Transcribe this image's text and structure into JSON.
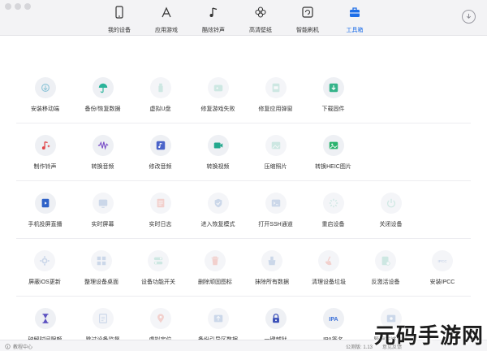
{
  "nav": {
    "items": [
      {
        "label": "我的设备",
        "icon": "phone-icon"
      },
      {
        "label": "应用游戏",
        "icon": "app-store-icon"
      },
      {
        "label": "酷炫铃声",
        "icon": "music-note-icon"
      },
      {
        "label": "高清壁纸",
        "icon": "flower-icon"
      },
      {
        "label": "智能刷机",
        "icon": "flash-icon"
      },
      {
        "label": "工具箱",
        "icon": "toolbox-icon"
      }
    ],
    "active_index": 5
  },
  "tools": [
    [
      {
        "label": "安装移动端",
        "icon": "install-icon",
        "color": "#8ec5d8",
        "faded": false
      },
      {
        "label": "备份/恢复数据",
        "icon": "umbrella-icon",
        "color": "#2bb39a",
        "faded": false
      },
      {
        "label": "虚拟U盘",
        "icon": "usb-icon",
        "color": "#9fd8c8",
        "faded": true
      },
      {
        "label": "修复游戏失败",
        "icon": "repair-game-icon",
        "color": "#9fd8c8",
        "faded": true
      },
      {
        "label": "修复应用弹窗",
        "icon": "repair-popup-icon",
        "color": "#9fd8c8",
        "faded": true
      },
      {
        "label": "下载固件",
        "icon": "download-firmware-icon",
        "color": "#35b38a",
        "faded": false
      }
    ],
    [
      {
        "label": "制作铃声",
        "icon": "ringtone-icon",
        "color": "#e0464a",
        "faded": false
      },
      {
        "label": "转换音频",
        "icon": "audio-wave-icon",
        "color": "#7b4fc8",
        "faded": false
      },
      {
        "label": "修改音频",
        "icon": "edit-audio-icon",
        "color": "#4a63c9",
        "faded": false
      },
      {
        "label": "转换视频",
        "icon": "video-icon",
        "color": "#24a88e",
        "faded": false
      },
      {
        "label": "压缩照片",
        "icon": "compress-photo-icon",
        "color": "#9fd8c8",
        "faded": true
      },
      {
        "label": "转换HEIC图片",
        "icon": "heic-image-icon",
        "color": "#2bb36e",
        "faded": false
      }
    ],
    [
      {
        "label": "手机投屏直播",
        "icon": "screen-cast-icon",
        "color": "#2f62c8",
        "faded": false
      },
      {
        "label": "实时屏幕",
        "icon": "live-screen-icon",
        "color": "#9ab3d8",
        "faded": true
      },
      {
        "label": "实时日志",
        "icon": "log-icon",
        "color": "#f0a59a",
        "faded": true
      },
      {
        "label": "进入恢复模式",
        "icon": "shield-icon",
        "color": "#9ab3d8",
        "faded": true
      },
      {
        "label": "打开SSH通道",
        "icon": "ssh-icon",
        "color": "#9ab3d8",
        "faded": true
      },
      {
        "label": "重启设备",
        "icon": "restart-icon",
        "color": "#9fd8c8",
        "faded": true
      },
      {
        "label": "关闭设备",
        "icon": "power-icon",
        "color": "#9fd8c8",
        "faded": true
      }
    ],
    [
      {
        "label": "屏蔽iOS更新",
        "icon": "gear-icon",
        "color": "#9ab3d8",
        "faded": true
      },
      {
        "label": "整理设备桌面",
        "icon": "grid-icon",
        "color": "#9ab3d8",
        "faded": true
      },
      {
        "label": "设备功能开关",
        "icon": "toggle-icon",
        "color": "#9fd8c8",
        "faded": true
      },
      {
        "label": "删除顽固图标",
        "icon": "trash-icon",
        "color": "#f0a59a",
        "faded": true
      },
      {
        "label": "抹除所有数据",
        "icon": "erase-icon",
        "color": "#9ab3d8",
        "faded": true
      },
      {
        "label": "清理设备垃圾",
        "icon": "broom-icon",
        "color": "#f0a59a",
        "faded": true
      },
      {
        "label": "反激活设备",
        "icon": "deactivate-icon",
        "color": "#9fd8c8",
        "faded": true
      },
      {
        "label": "安装IPCC",
        "icon": "ipcc-icon",
        "color": "#9ab3d8",
        "faded": true
      }
    ],
    [
      {
        "label": "破解时间限额",
        "icon": "hourglass-icon",
        "color": "#5a4fc0",
        "faded": false
      },
      {
        "label": "跳过设备监督",
        "icon": "document-icon",
        "color": "#9ab3d8",
        "faded": true
      },
      {
        "label": "虚拟定位",
        "icon": "location-icon",
        "color": "#f0a59a",
        "faded": true
      },
      {
        "label": "备份引导区数据",
        "icon": "backup-boot-icon",
        "color": "#9ab3d8",
        "faded": true
      },
      {
        "label": "一键越狱",
        "icon": "lock-icon",
        "color": "#3a4fb8",
        "faded": false
      },
      {
        "label": "IPA签名",
        "icon": "ipa-icon",
        "color": "#3a6fd8",
        "faded": false
      },
      {
        "label": "管理描述文件",
        "icon": "profile-icon",
        "color": "#9ab3d8",
        "faded": true
      }
    ]
  ],
  "status": {
    "tutorial": "教程中心",
    "version": "公测版: 1.13",
    "feedback": "意见反馈"
  },
  "watermark": "元码手游网"
}
